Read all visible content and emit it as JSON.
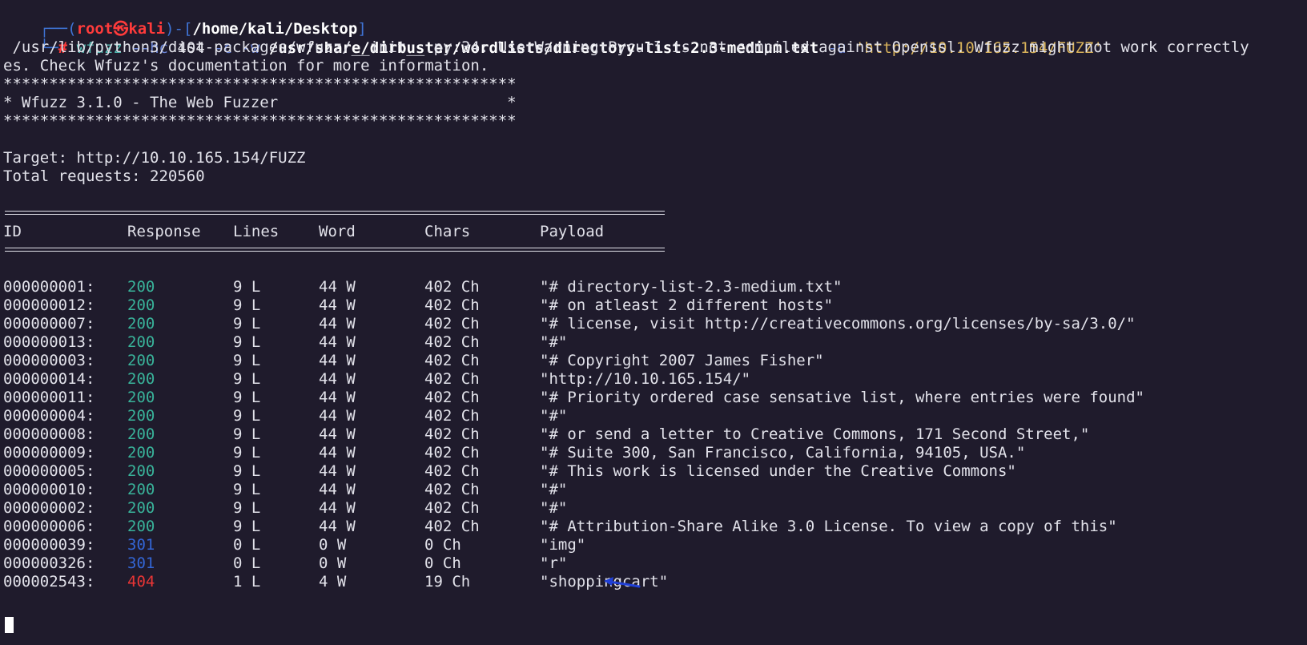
{
  "prompt": {
    "corner_top": "┌──(",
    "user": "root",
    "at": "㉿",
    "host": "kali",
    "mid": ")-[",
    "path": "/home/kali/Desktop",
    "end": "]",
    "corner_bottom": "└─",
    "hash": "#"
  },
  "command": {
    "name": "wfuzz",
    "opt_hc": "--hc",
    "hc_value": "404",
    "opt_c": "-c",
    "opt_w": "-w",
    "wordlist": "/usr/share/dirbuster/wordlists/directory-list-2.3-medium.txt",
    "opt_u": "-u",
    "url": "'http://10.10.165.154/FUZZ'"
  },
  "warning": {
    "line1": " /usr/lib/python3/dist-packages/wfuzz/__init__.py:34: UserWarning:Pycurl is not compiled against Openssl. Wfuzz might not work correctly",
    "line2": "es. Check Wfuzz's documentation for more information."
  },
  "banner": {
    "stars": "********************************************************",
    "title": "* Wfuzz 3.1.0 - The Web Fuzzer                         *"
  },
  "target_line": "Target: http://10.10.165.154/FUZZ",
  "total_line": "Total requests: 220560",
  "table": {
    "headers": {
      "id": "ID",
      "response": "Response",
      "lines": "Lines",
      "word": "Word",
      "chars": "Chars",
      "payload": "Payload"
    },
    "rows": [
      {
        "id": "000000001:",
        "response": "200",
        "lines": "9 L",
        "word": "44 W",
        "chars": "402 Ch",
        "payload": "\"# directory-list-2.3-medium.txt\""
      },
      {
        "id": "000000012:",
        "response": "200",
        "lines": "9 L",
        "word": "44 W",
        "chars": "402 Ch",
        "payload": "\"# on atleast 2 different hosts\""
      },
      {
        "id": "000000007:",
        "response": "200",
        "lines": "9 L",
        "word": "44 W",
        "chars": "402 Ch",
        "payload": "\"# license, visit http://creativecommons.org/licenses/by-sa/3.0/\""
      },
      {
        "id": "000000013:",
        "response": "200",
        "lines": "9 L",
        "word": "44 W",
        "chars": "402 Ch",
        "payload": "\"#\""
      },
      {
        "id": "000000003:",
        "response": "200",
        "lines": "9 L",
        "word": "44 W",
        "chars": "402 Ch",
        "payload": "\"# Copyright 2007 James Fisher\""
      },
      {
        "id": "000000014:",
        "response": "200",
        "lines": "9 L",
        "word": "44 W",
        "chars": "402 Ch",
        "payload": "\"http://10.10.165.154/\""
      },
      {
        "id": "000000011:",
        "response": "200",
        "lines": "9 L",
        "word": "44 W",
        "chars": "402 Ch",
        "payload": "\"# Priority ordered case sensative list, where entries were found\""
      },
      {
        "id": "000000004:",
        "response": "200",
        "lines": "9 L",
        "word": "44 W",
        "chars": "402 Ch",
        "payload": "\"#\""
      },
      {
        "id": "000000008:",
        "response": "200",
        "lines": "9 L",
        "word": "44 W",
        "chars": "402 Ch",
        "payload": "\"# or send a letter to Creative Commons, 171 Second Street,\""
      },
      {
        "id": "000000009:",
        "response": "200",
        "lines": "9 L",
        "word": "44 W",
        "chars": "402 Ch",
        "payload": "\"# Suite 300, San Francisco, California, 94105, USA.\""
      },
      {
        "id": "000000005:",
        "response": "200",
        "lines": "9 L",
        "word": "44 W",
        "chars": "402 Ch",
        "payload": "\"# This work is licensed under the Creative Commons\""
      },
      {
        "id": "000000010:",
        "response": "200",
        "lines": "9 L",
        "word": "44 W",
        "chars": "402 Ch",
        "payload": "\"#\""
      },
      {
        "id": "000000002:",
        "response": "200",
        "lines": "9 L",
        "word": "44 W",
        "chars": "402 Ch",
        "payload": "\"#\""
      },
      {
        "id": "000000006:",
        "response": "200",
        "lines": "9 L",
        "word": "44 W",
        "chars": "402 Ch",
        "payload": "\"# Attribution-Share Alike 3.0 License. To view a copy of this\""
      },
      {
        "id": "000000039:",
        "response": "301",
        "lines": "0 L",
        "word": "0 W",
        "chars": "0 Ch",
        "payload": "\"img\""
      },
      {
        "id": "000000326:",
        "response": "301",
        "lines": "0 L",
        "word": "0 W",
        "chars": "0 Ch",
        "payload": "\"r\""
      },
      {
        "id": "000002543:",
        "response": "404",
        "lines": "1 L",
        "word": "4 W",
        "chars": "19 Ch",
        "payload": "\"shoppingcart\""
      }
    ]
  },
  "colors": {
    "background": "#1f1b2c",
    "status_200": "#39b39a",
    "status_301": "#3366d6",
    "status_404": "#e83535",
    "annotation_arrow": "#1f3fd6"
  },
  "annotation": {
    "icon": "arrow-left-icon"
  }
}
